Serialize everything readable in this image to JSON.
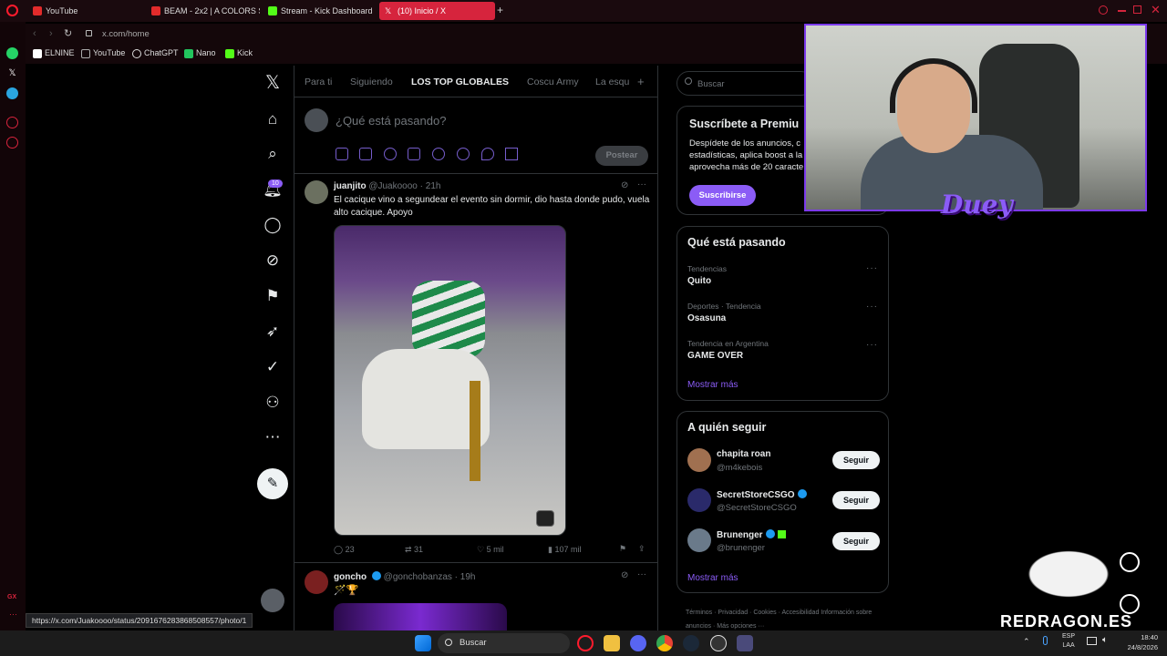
{
  "browser": {
    "tabs": [
      {
        "label": "YouTube",
        "color": "#e22b2b"
      },
      {
        "label": "BEAM - 2x2 | A COLORS S",
        "color": "#e22b2b"
      },
      {
        "label": "Stream - Kick Dashboard",
        "color": "#53fc18"
      },
      {
        "label": "(10) Inicio / X",
        "color": "#ffffff"
      }
    ],
    "url": "x.com/home",
    "bookmarks": [
      {
        "label": "ELNINE",
        "color": "#ffffff"
      },
      {
        "label": "YouTube",
        "color": "#aaaaaa"
      },
      {
        "label": "ChatGPT",
        "color": "#dddddd"
      },
      {
        "label": "Nano",
        "color": "#22c55e"
      },
      {
        "label": "Kick",
        "color": "#53fc18"
      }
    ],
    "status_url": "https://x.com/Juakoooo/status/2091676283868508557/photo/1",
    "sidebar_gx": "GX"
  },
  "x": {
    "notif_badge": "10",
    "tabs": [
      "Para ti",
      "Siguiendo",
      "LOS TOP GLOBALES",
      "Coscu Army",
      "La esqu"
    ],
    "compose_placeholder": "¿Qué está pasando?",
    "post_button": "Postear",
    "post1": {
      "name": "juanjito",
      "handle": "@Juakoooo",
      "time": "· 21h",
      "text": "El cacique vino a segundear el evento sin dormir, dio hasta donde pudo, vuela alto cacique. Apoyo",
      "replies": "23",
      "reposts": "31",
      "likes": "5 mil",
      "views": "107 mil"
    },
    "post2": {
      "name": "goncho",
      "handle": "@gonchobanzas",
      "time": "· 19h",
      "text": "🪄🏆"
    },
    "search_placeholder": "Buscar",
    "premium": {
      "title": "Suscríbete a Premiu",
      "body": "Despídete de los anuncios, c estadísticas, aplica boost a la aprovecha más de 20 caracte",
      "button": "Suscribirse"
    },
    "trending": {
      "title": "Qué está pasando",
      "items": [
        {
          "meta": "Tendencias",
          "name": "Quito"
        },
        {
          "meta": "Deportes · Tendencia",
          "name": "Osasuna"
        },
        {
          "meta": "Tendencia en Argentina",
          "name": "GAME OVER"
        }
      ],
      "more": "Mostrar más"
    },
    "follow": {
      "title": "A quién seguir",
      "items": [
        {
          "name": "chapita roan",
          "handle": "@m4kebois",
          "button": "Seguir",
          "verified": false
        },
        {
          "name": "SecretStoreCSGO",
          "handle": "@SecretStoreCSGO",
          "button": "Seguir",
          "verified": true
        },
        {
          "name": "Brunenger",
          "handle": "@brunenger",
          "button": "Seguir",
          "verified": true
        }
      ],
      "more": "Mostrar más"
    },
    "footer": [
      "Términos",
      "Privacidad",
      "Cookies",
      "Accesibilidad",
      "Información sobre anuncios",
      "Más opciones ···"
    ]
  },
  "overlay": {
    "webcam_logo": "Duey",
    "brand": "REDRAGON.ES"
  },
  "taskbar": {
    "search": "Buscar",
    "lang1": "ESP",
    "lang2": "LAA",
    "time": "18:40",
    "date": "24/8/2026"
  }
}
